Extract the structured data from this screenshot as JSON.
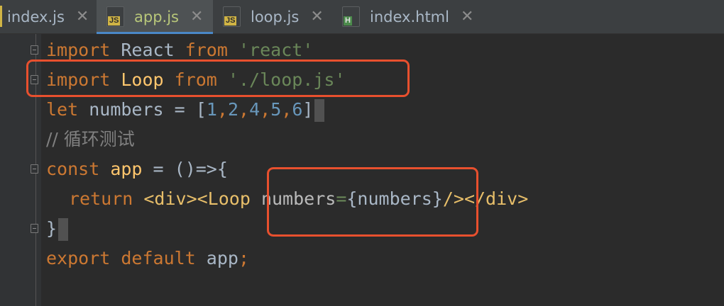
{
  "tabs": [
    {
      "name": "index.js",
      "type": "JS",
      "active": false
    },
    {
      "name": "app.js",
      "type": "JS",
      "active": true
    },
    {
      "name": "loop.js",
      "type": "JS",
      "active": false
    },
    {
      "name": "index.html",
      "type": "H",
      "active": false
    }
  ],
  "close_glyph": "✕",
  "code": {
    "line1": {
      "kw1": "import",
      "id": "React",
      "kw2": "from",
      "str": "'react'"
    },
    "line2": {
      "kw1": "import",
      "cls": "Loop",
      "kw2": "from",
      "str": "'./loop.js'"
    },
    "line3": {
      "kw": "let",
      "id": "numbers",
      "eq": "=",
      "open": "[",
      "n1": "1",
      "n2": "2",
      "n3": "4",
      "n4": "5",
      "n5": "6",
      "close": "]"
    },
    "line4": {
      "comment": "// 循环测试"
    },
    "line5": {
      "kw": "const",
      "cls": "app",
      "rest": "= ()=>{"
    },
    "line6": {
      "kw": "return",
      "tag_open": "<div><Loop",
      "attr": "numbers",
      "eq": "=",
      "expr": "{numbers}",
      "tag_close": "/></div>"
    },
    "line7": {
      "brace": "}"
    },
    "line8": {
      "kw": "export default",
      "id": "app",
      "semi": ";"
    }
  },
  "colors": {
    "annotation": "#e8502e"
  }
}
